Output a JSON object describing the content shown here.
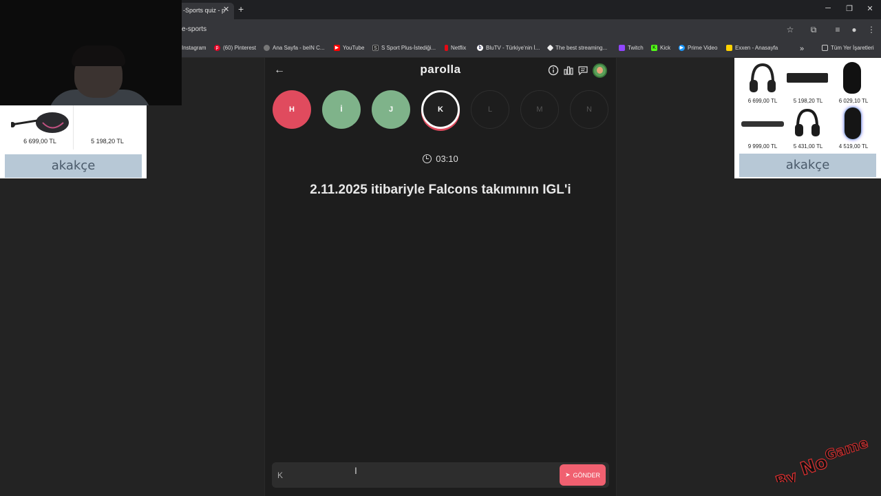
{
  "browser": {
    "tab_title": "-Sports quiz - p",
    "url": "e-sports",
    "bookmarks": [
      "Instagram",
      "(60) Pinterest",
      "Ana Sayfa - beIN C...",
      "YouTube",
      "S Sport Plus-İstediği...",
      "Netflix",
      "BluTV - Türkiye'nin İ...",
      "The best streaming...",
      "Twitch",
      "Kick",
      "Prime Video",
      "Exxen - Anasayfa"
    ],
    "all_bookmarks": "Tüm Yer İşaretleri"
  },
  "ads": {
    "left_prices": [
      "6 699,00 TL",
      "5 198,20 TL"
    ],
    "right_prices": [
      "6 699,00 TL",
      "5 198,20 TL",
      "6 029,10 TL",
      "9 999,00 TL",
      "5 431,00 TL",
      "4 519,00 TL"
    ],
    "logo": "akakçe"
  },
  "game": {
    "title": "parolla",
    "letters": [
      {
        "char": "H",
        "state": "wrong"
      },
      {
        "char": "İ",
        "state": "right"
      },
      {
        "char": "J",
        "state": "right"
      },
      {
        "char": "K",
        "state": "current"
      },
      {
        "char": "L",
        "state": "pending"
      },
      {
        "char": "M",
        "state": "pending"
      },
      {
        "char": "N",
        "state": "pending"
      }
    ],
    "timer": "03:10",
    "question": "2.11.2025 itibariyle Falcons takımının IGL'i",
    "answer_value": "K",
    "submit_label": "GÖNDER"
  },
  "watermark": "ByNoGame",
  "colors": {
    "wrong": "#e04b5e",
    "right": "#7fb38a",
    "accent": "#f06070"
  }
}
